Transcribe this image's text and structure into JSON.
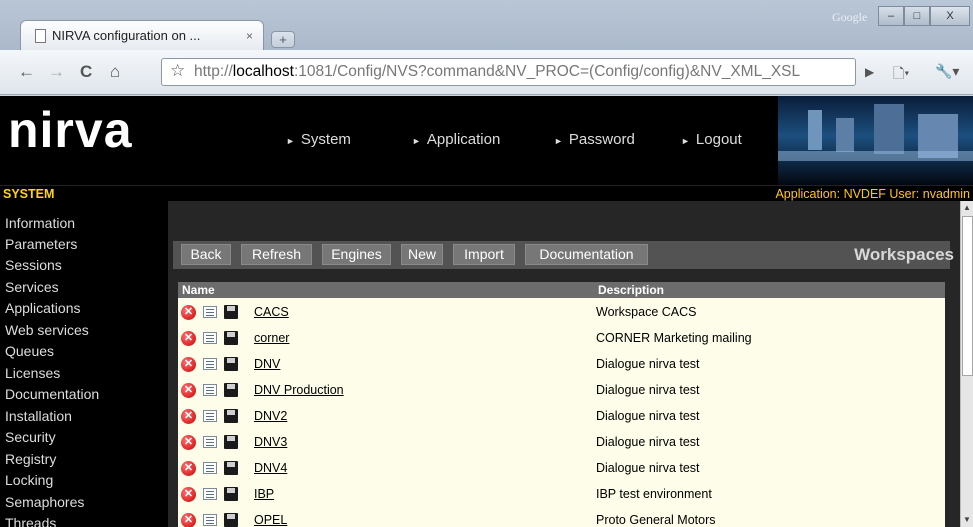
{
  "browser": {
    "tab_title": "NIRVA configuration on ...",
    "tab_close": "×",
    "new_tab": "+",
    "corner_label": "Google",
    "window_buttons": [
      "–",
      "□",
      "X"
    ],
    "nav_icons": {
      "back": "←",
      "forward": "→",
      "reload": "C",
      "home": "⌂",
      "star": "☆",
      "go": "▶",
      "page": "🗋▾",
      "wrench": "🔧▾"
    },
    "url_prefix": "http://",
    "url_host": "localhost",
    "url_rest": ":1081/Config/NVS?command&NV_PROC=(Config/config)&NV_XML_XSL"
  },
  "header": {
    "logo": "nirva",
    "menu": [
      {
        "arrow": "►",
        "label": "System"
      },
      {
        "arrow": "►",
        "label": "Application"
      },
      {
        "arrow": "►",
        "label": "Password"
      },
      {
        "arrow": "►",
        "label": "Logout"
      }
    ]
  },
  "status": {
    "section": "SYSTEM",
    "app_info": "Application: NVDEF  User: nvadmin"
  },
  "sidebar": {
    "items": [
      "Information",
      "Parameters",
      "Sessions",
      "Services",
      "Applications",
      "Web services",
      "Queues",
      "Licenses",
      "Documentation",
      "Installation",
      "Security",
      "Registry",
      "Locking",
      "Semaphores",
      "Threads"
    ]
  },
  "toolbar": {
    "buttons": [
      "Back",
      "Refresh",
      "Engines",
      "New",
      "Import",
      "Documentation"
    ],
    "title": "Workspaces"
  },
  "table": {
    "headers": {
      "name": "Name",
      "description": "Description"
    },
    "delete_glyph": "✕",
    "rows": [
      {
        "name": "CACS",
        "description": "Workspace CACS"
      },
      {
        "name": "corner",
        "description": "CORNER Marketing mailing"
      },
      {
        "name": "DNV",
        "description": "Dialogue nirva test"
      },
      {
        "name": "DNV Production",
        "description": "Dialogue nirva test"
      },
      {
        "name": "DNV2",
        "description": "Dialogue nirva test"
      },
      {
        "name": "DNV3",
        "description": "Dialogue nirva test"
      },
      {
        "name": "DNV4",
        "description": "Dialogue nirva test"
      },
      {
        "name": "IBP",
        "description": "IBP test environment"
      },
      {
        "name": "OPEL",
        "description": "Proto General Motors"
      }
    ]
  },
  "scrollbar": {
    "up": "▲",
    "down": "▼"
  }
}
